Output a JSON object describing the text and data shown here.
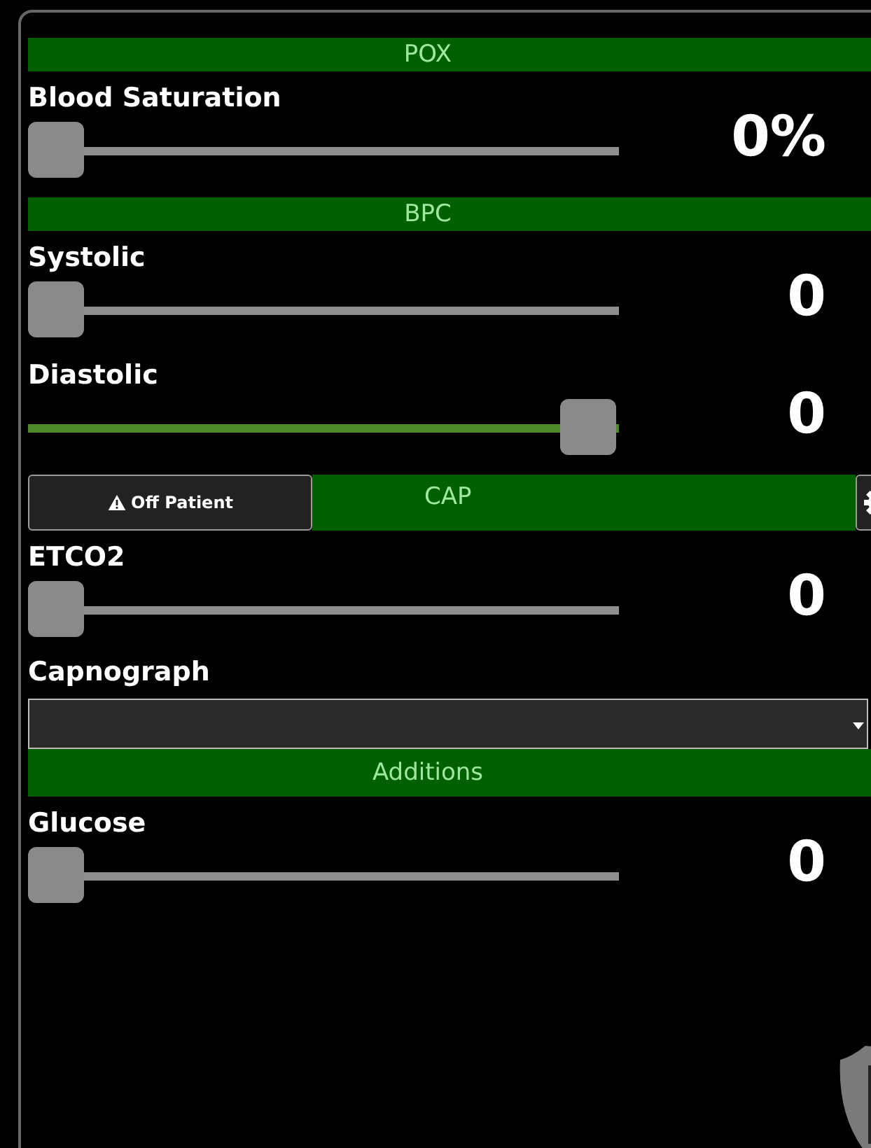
{
  "sections": [
    {
      "title": "POX",
      "rows": [
        {
          "kind": "slider",
          "label": "Blood Saturation",
          "level": 0,
          "reading": "0%"
        }
      ]
    },
    {
      "title": "BPC",
      "rows": [
        {
          "kind": "slider",
          "label": "Systolic",
          "level": 0,
          "reading": "0"
        },
        {
          "kind": "slider",
          "label": "Diastolic",
          "level": 1,
          "reading": "0"
        }
      ]
    },
    {
      "title": "CAP",
      "status_button": "Off Patient",
      "rows": [
        {
          "kind": "slider",
          "label": "ETCO2",
          "level": 0,
          "reading": "0"
        },
        {
          "kind": "dropdown",
          "label": "Capnograph"
        }
      ]
    },
    {
      "title": "Additions",
      "rows": [
        {
          "kind": "slider",
          "label": "Glucose",
          "level": 0,
          "reading": "0"
        }
      ]
    }
  ]
}
